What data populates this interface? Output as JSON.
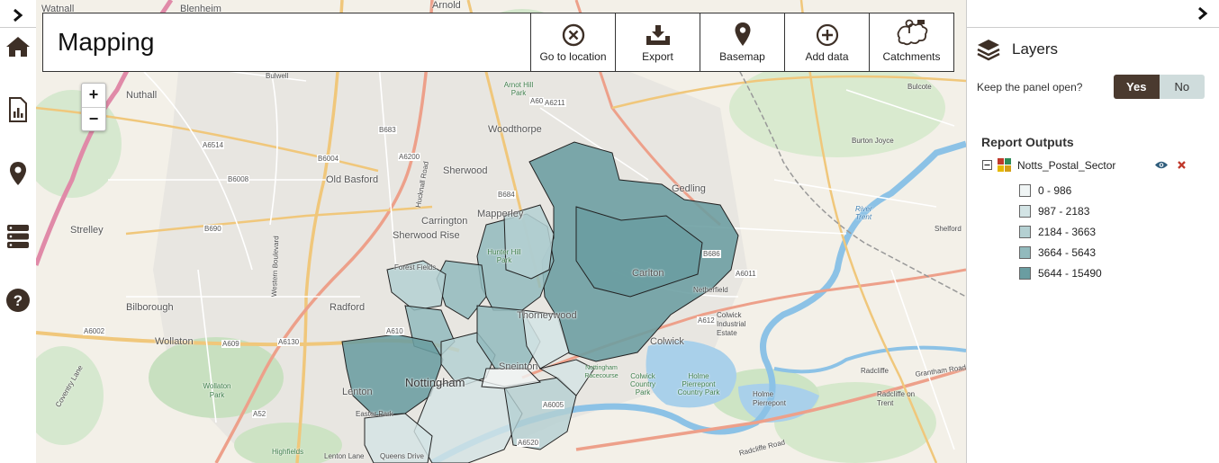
{
  "toolbar": {
    "title": "Mapping",
    "tools": [
      {
        "label": "Go to location",
        "icon": "cancel-circle-icon"
      },
      {
        "label": "Export",
        "icon": "export-tray-icon"
      },
      {
        "label": "Basemap",
        "icon": "map-pin-icon"
      },
      {
        "label": "Add data",
        "icon": "plus-circle-icon"
      },
      {
        "label": "Catchments",
        "icon": "catchments-icon"
      }
    ]
  },
  "zoom": {
    "in": "+",
    "out": "−"
  },
  "left_rail": [
    {
      "name": "expand-chevron-icon"
    },
    {
      "name": "home-icon"
    },
    {
      "name": "report-icon"
    },
    {
      "name": "location-pin-icon"
    },
    {
      "name": "database-icon"
    },
    {
      "name": "help-icon"
    }
  ],
  "panel": {
    "title": "Layers",
    "keep_open_label": "Keep the panel open?",
    "yes": "Yes",
    "no": "No",
    "report_outputs": "Report Outputs",
    "layer_name": "Notts_Postal_Sector",
    "legend": [
      {
        "label": "0 - 986",
        "color": "#f0f5f5"
      },
      {
        "label": "987 - 2183",
        "color": "#d3e4e5"
      },
      {
        "label": "2184 - 3663",
        "color": "#b4d0d2"
      },
      {
        "label": "3664 - 5643",
        "color": "#92babd"
      },
      {
        "label": "5644 - 15490",
        "color": "#6a9da1"
      }
    ]
  },
  "map_labels": {
    "places": [
      "Watnall",
      "Blenheim",
      "Nuthall",
      "Bulwell",
      "Woodthorpe",
      "Sherwood",
      "Old Basford",
      "Arnold",
      "Gedling",
      "Burton Joyce",
      "Carrington",
      "Mapperley",
      "Strelley",
      "Sherwood Rise",
      "Forest Fields",
      "Carlton",
      "Netherfield",
      "Bilborough",
      "Radford",
      "Thorneywood",
      "Colwick Industrial Estate",
      "Colwick",
      "Wollaton",
      "Sneinton",
      "Nottingham",
      "Lenton",
      "Radcliffe",
      "Radcliffe on Trent",
      "Holme Pierrepont",
      "Shelford",
      "Bulcote",
      "Lenton Lane",
      "Queens Drive",
      "Easter Park"
    ],
    "green": [
      "Wollaton Park",
      "Highfields",
      "Colwick Country Park",
      "Holme Pierrepont Country Park",
      "Nottingham Racecourse",
      "Arnot Hill Park",
      "Hunter Hill Park"
    ],
    "water": [
      "River Trent"
    ],
    "roads": [
      "A6002",
      "A609",
      "A52",
      "A60",
      "A610",
      "A6130",
      "A6514",
      "B683",
      "B684",
      "B6004",
      "B6008",
      "B690",
      "A6211",
      "A612",
      "A6011",
      "A6005",
      "A6520",
      "A6200",
      "B686"
    ],
    "road_names": [
      "Western Boulevard",
      "Hucknall Road",
      "Coventry Lane",
      "Radcliffe Road",
      "Grantham Road"
    ]
  }
}
